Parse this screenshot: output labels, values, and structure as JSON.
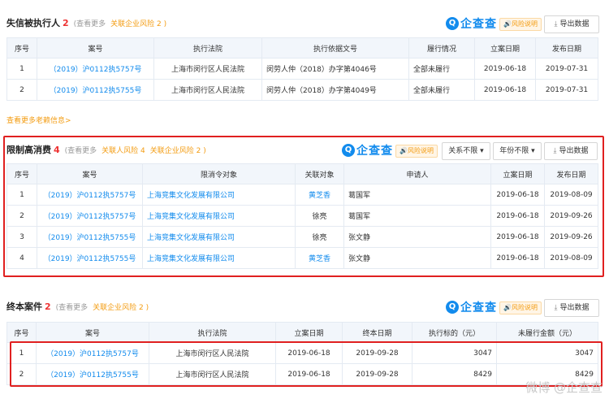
{
  "s1": {
    "title": "失信被执行人",
    "count": "2",
    "more": "(查看更多",
    "risk": "关联企业风险 2 )",
    "brand": "企查查",
    "risk_tag": "风险说明",
    "export": "导出数据",
    "headers": [
      "序号",
      "案号",
      "执行法院",
      "执行依据文号",
      "履行情况",
      "立案日期",
      "发布日期"
    ],
    "rows": [
      [
        "1",
        "（2019）沪0112执5757号",
        "上海市闵行区人民法院",
        "闵劳人仲（2018）办字第4046号",
        "全部未履行",
        "2019-06-18",
        "2019-07-31"
      ],
      [
        "2",
        "（2019）沪0112执5755号",
        "上海市闵行区人民法院",
        "闵劳人仲（2018）办字第4049号",
        "全部未履行",
        "2019-06-18",
        "2019-07-31"
      ]
    ],
    "old_link": "查看更多老赖信息>"
  },
  "s2": {
    "title": "限制高消费",
    "count": "4",
    "more": "(查看更多",
    "risk_person": "关联人风险 4",
    "risk": "关联企业风险 2 )",
    "brand": "企查查",
    "risk_tag": "风险说明",
    "filter_relation": "关系不限",
    "filter_year": "年份不限",
    "export": "导出数据",
    "headers": [
      "序号",
      "案号",
      "限消令对象",
      "关联对象",
      "申请人",
      "立案日期",
      "发布日期"
    ],
    "rows": [
      [
        "1",
        "（2019）沪0112执5757号",
        "上海竞集文化发展有限公司",
        "黄芝香",
        "葛国军",
        "2019-06-18",
        "2019-08-09"
      ],
      [
        "2",
        "（2019）沪0112执5757号",
        "上海竞集文化发展有限公司",
        "徐亮",
        "葛国军",
        "2019-06-18",
        "2019-09-26"
      ],
      [
        "3",
        "（2019）沪0112执5755号",
        "上海竞集文化发展有限公司",
        "徐亮",
        "张文静",
        "2019-06-18",
        "2019-09-26"
      ],
      [
        "4",
        "（2019）沪0112执5755号",
        "上海竞集文化发展有限公司",
        "黄芝香",
        "张文静",
        "2019-06-18",
        "2019-08-09"
      ]
    ]
  },
  "s3": {
    "title": "终本案件",
    "count": "2",
    "more": "(查看更多",
    "risk": "关联企业风险 2 )",
    "brand": "企查查",
    "risk_tag": "风险说明",
    "export": "导出数据",
    "headers": [
      "序号",
      "案号",
      "执行法院",
      "立案日期",
      "终本日期",
      "执行标的（元）",
      "未履行金额（元）"
    ],
    "rows": [
      [
        "1",
        "（2019）沪0112执5757号",
        "上海市闵行区人民法院",
        "2019-06-18",
        "2019-09-28",
        "3047",
        "3047"
      ],
      [
        "2",
        "（2019）沪0112执5755号",
        "上海市闵行区人民法院",
        "2019-06-18",
        "2019-09-28",
        "8429",
        "8429"
      ]
    ]
  },
  "watermark": "微博 @企查查",
  "colors": {
    "accent": "#128bed",
    "count": "#e33333",
    "risk": "#f39c12",
    "highlight_box": "#e02020",
    "header_bg": "#f2f6fb"
  }
}
